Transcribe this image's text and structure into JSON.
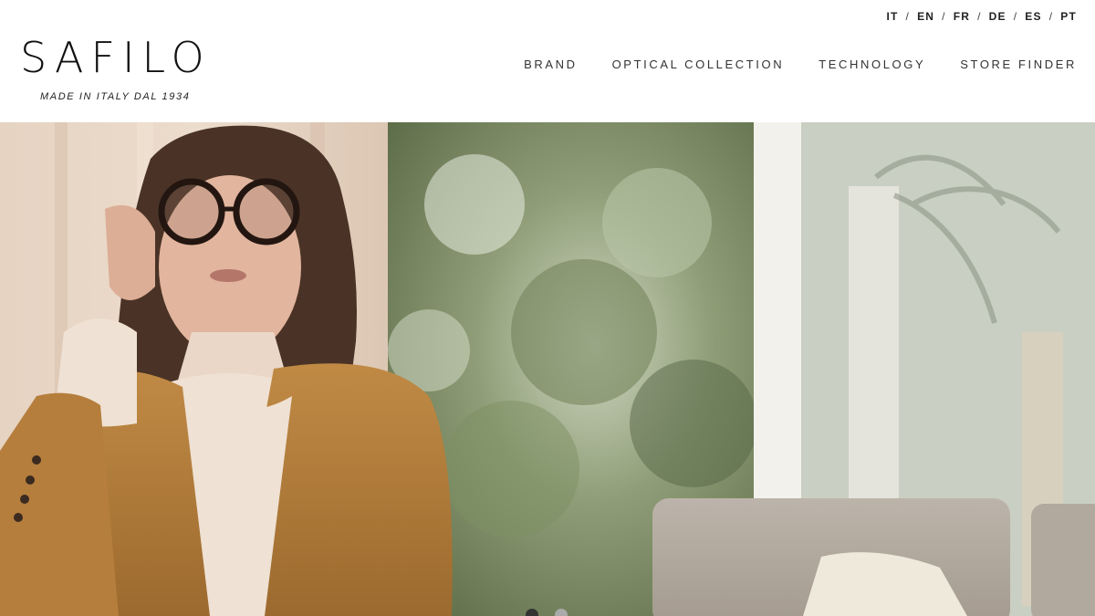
{
  "header": {
    "logo": "SAFILO",
    "tagline": "MADE IN ITALY DAL 1934",
    "languages": [
      {
        "label": "IT"
      },
      {
        "label": "EN"
      },
      {
        "label": "FR"
      },
      {
        "label": "DE"
      },
      {
        "label": "ES"
      },
      {
        "label": "PT"
      }
    ],
    "lang_separator": "/",
    "nav": [
      {
        "label": "BRAND"
      },
      {
        "label": "OPTICAL COLLECTION"
      },
      {
        "label": "TECHNOLOGY"
      },
      {
        "label": "STORE FINDER"
      }
    ]
  },
  "hero": {
    "image_alt": "Woman wearing round eyeglasses in a camel coat",
    "slides": [
      {
        "state": "active"
      },
      {
        "state": "inactive"
      }
    ]
  }
}
